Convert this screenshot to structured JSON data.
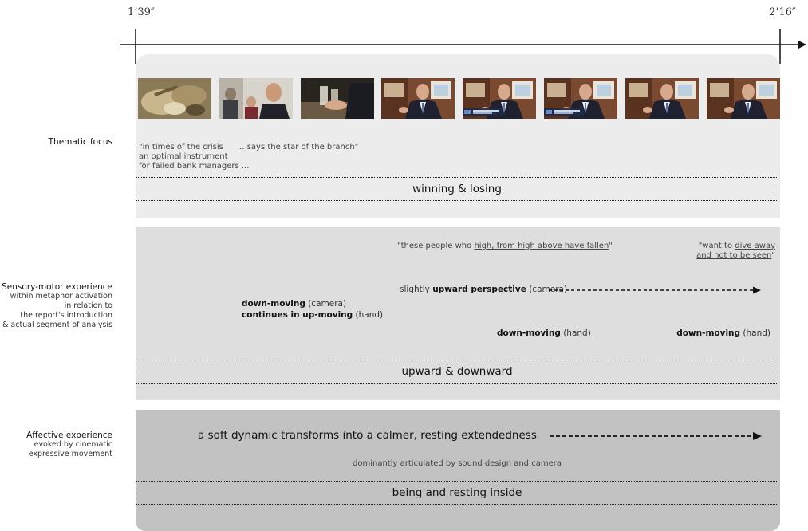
{
  "timeline": {
    "start": "1’39″",
    "end": "2’16″"
  },
  "rows": {
    "thematic": {
      "label": "Thematic focus",
      "quote_a1": "\"in times of the crisis",
      "quote_a2": "an optimal instrument",
      "quote_a3": "for failed bank managers ...",
      "quote_b": "... says the star of the branch\"",
      "summary": "winning & losing"
    },
    "sensory": {
      "label_title": "Sensory-motor experience",
      "label_l2": "within metaphor activation",
      "label_l3": "in relation to",
      "label_l4": "the report's introduction",
      "label_l5": "& actual segment of analysis",
      "quote_center_pre": "\"these people who ",
      "quote_center_underlined": "high, from high above have fallen",
      "quote_center_post": "\"",
      "quote_right_pre": "\"want to ",
      "quote_right_u1": "dive away",
      "quote_right_u2": "and not to be seen",
      "quote_right_post": "\"",
      "perspective_pre": "slightly ",
      "perspective_bold": "upward perspective",
      "perspective_post": " (camera)",
      "left_l1_bold": "down-moving",
      "left_l1_rest": " (camera)",
      "left_l2_bold": "continues in up-moving",
      "left_l2_rest": " (hand)",
      "mid_bold": "down-moving",
      "mid_rest": " (hand)",
      "right_bold": "down-moving",
      "right_rest": " (hand)",
      "summary": "upward & downward"
    },
    "affective": {
      "label_title": "Affective experience",
      "label_l2": "evoked by cinematic",
      "label_l3": "expressive movement",
      "main": "a soft dynamic transforms into a calmer, resting extendedness",
      "sub": "dominantly articulated by sound design and camera",
      "summary": "being and resting inside"
    }
  },
  "stills": [
    {
      "name": "food-still",
      "scene": "food"
    },
    {
      "name": "dining-people-still",
      "scene": "diners"
    },
    {
      "name": "hands-table-still",
      "scene": "hands"
    },
    {
      "name": "interview-still",
      "scene": "interview"
    },
    {
      "name": "interview-still-caption",
      "scene": "interview-caption"
    },
    {
      "name": "interview-still-caption",
      "scene": "interview-caption"
    },
    {
      "name": "interview-still",
      "scene": "interview"
    },
    {
      "name": "interview-still",
      "scene": "interview"
    }
  ],
  "colors": {
    "panel_thematic": "#ececec",
    "panel_sensory": "#dedede",
    "panel_affective": "#c2c2c2"
  }
}
